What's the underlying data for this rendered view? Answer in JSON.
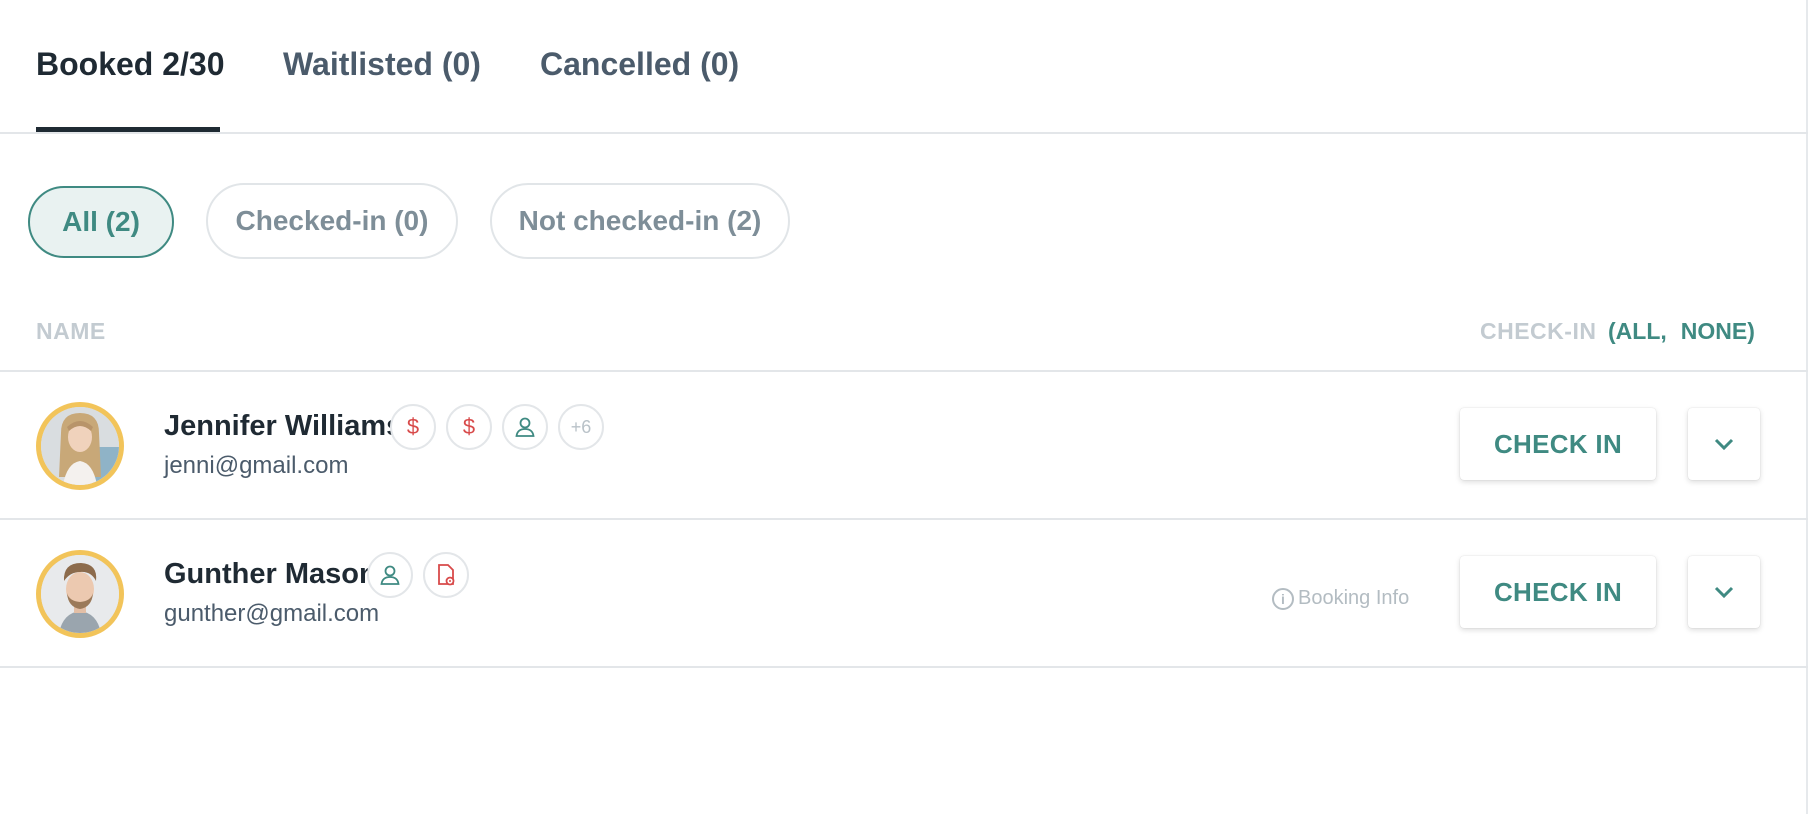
{
  "tabs": [
    {
      "label": "Booked 2/30",
      "active": true
    },
    {
      "label": "Waitlisted (0)",
      "active": false
    },
    {
      "label": "Cancelled (0)",
      "active": false
    }
  ],
  "filters": [
    {
      "label": "All (2)",
      "active": true
    },
    {
      "label": "Checked-in (0)",
      "active": false
    },
    {
      "label": "Not checked-in (2)",
      "active": false
    }
  ],
  "columns": {
    "name": "NAME",
    "checkin": "CHECK-IN",
    "all": "(ALL",
    "separator": ",",
    "none": "NONE)"
  },
  "attendees": [
    {
      "name": "Jennifer Williams",
      "email": "jenni@gmail.com",
      "badges": [
        {
          "icon": "dollar-icon",
          "glyph": "$",
          "color": "red"
        },
        {
          "icon": "dollar-icon",
          "glyph": "$",
          "color": "red"
        },
        {
          "icon": "user-icon",
          "color": "green"
        },
        {
          "icon": "more-count",
          "glyph": "+6",
          "color": "grey"
        }
      ],
      "checkin_label": "CHECK IN"
    },
    {
      "name": "Gunther Mason",
      "email": "gunther@gmail.com",
      "badges": [
        {
          "icon": "user-icon",
          "color": "green"
        },
        {
          "icon": "document-icon",
          "color": "red"
        }
      ],
      "booking_info": "Booking Info",
      "checkin_label": "CHECK IN"
    }
  ],
  "colors": {
    "accent": "#3f8a82",
    "avatar_ring": "#f2c45a",
    "alert": "#d84a4a",
    "text_dark": "#1f2a33"
  }
}
